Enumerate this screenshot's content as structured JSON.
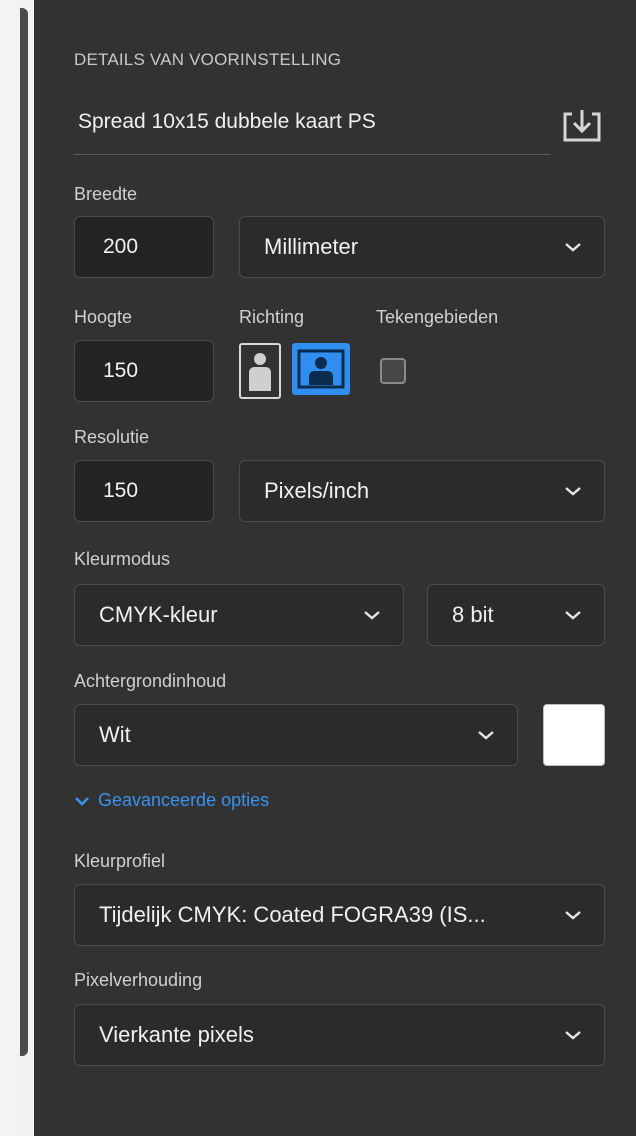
{
  "preset": {
    "section_title": "DETAILS VAN VOORINSTELLING",
    "name": "Spread 10x15 dubbele kaart PS"
  },
  "width": {
    "label": "Breedte",
    "value": "200",
    "unit": "Millimeter"
  },
  "height": {
    "label": "Hoogte",
    "value": "150"
  },
  "orientation": {
    "label": "Richting",
    "selected": "landscape"
  },
  "artboards": {
    "label": "Tekengebieden",
    "checked": false
  },
  "resolution": {
    "label": "Resolutie",
    "value": "150",
    "unit": "Pixels/inch"
  },
  "color_mode": {
    "label": "Kleurmodus",
    "mode": "CMYK-kleur",
    "depth": "8 bit"
  },
  "background": {
    "label": "Achtergrondinhoud",
    "value": "Wit",
    "swatch_color": "#ffffff"
  },
  "advanced": {
    "label": "Geavanceerde opties"
  },
  "color_profile": {
    "label": "Kleurprofiel",
    "value": "Tijdelijk CMYK: Coated FOGRA39 (IS..."
  },
  "pixel_aspect": {
    "label": "Pixelverhouding",
    "value": "Vierkante pixels"
  },
  "colors": {
    "panel_bg": "#323232",
    "accent_blue": "#2f8ef0",
    "field_bg": "#232323"
  }
}
